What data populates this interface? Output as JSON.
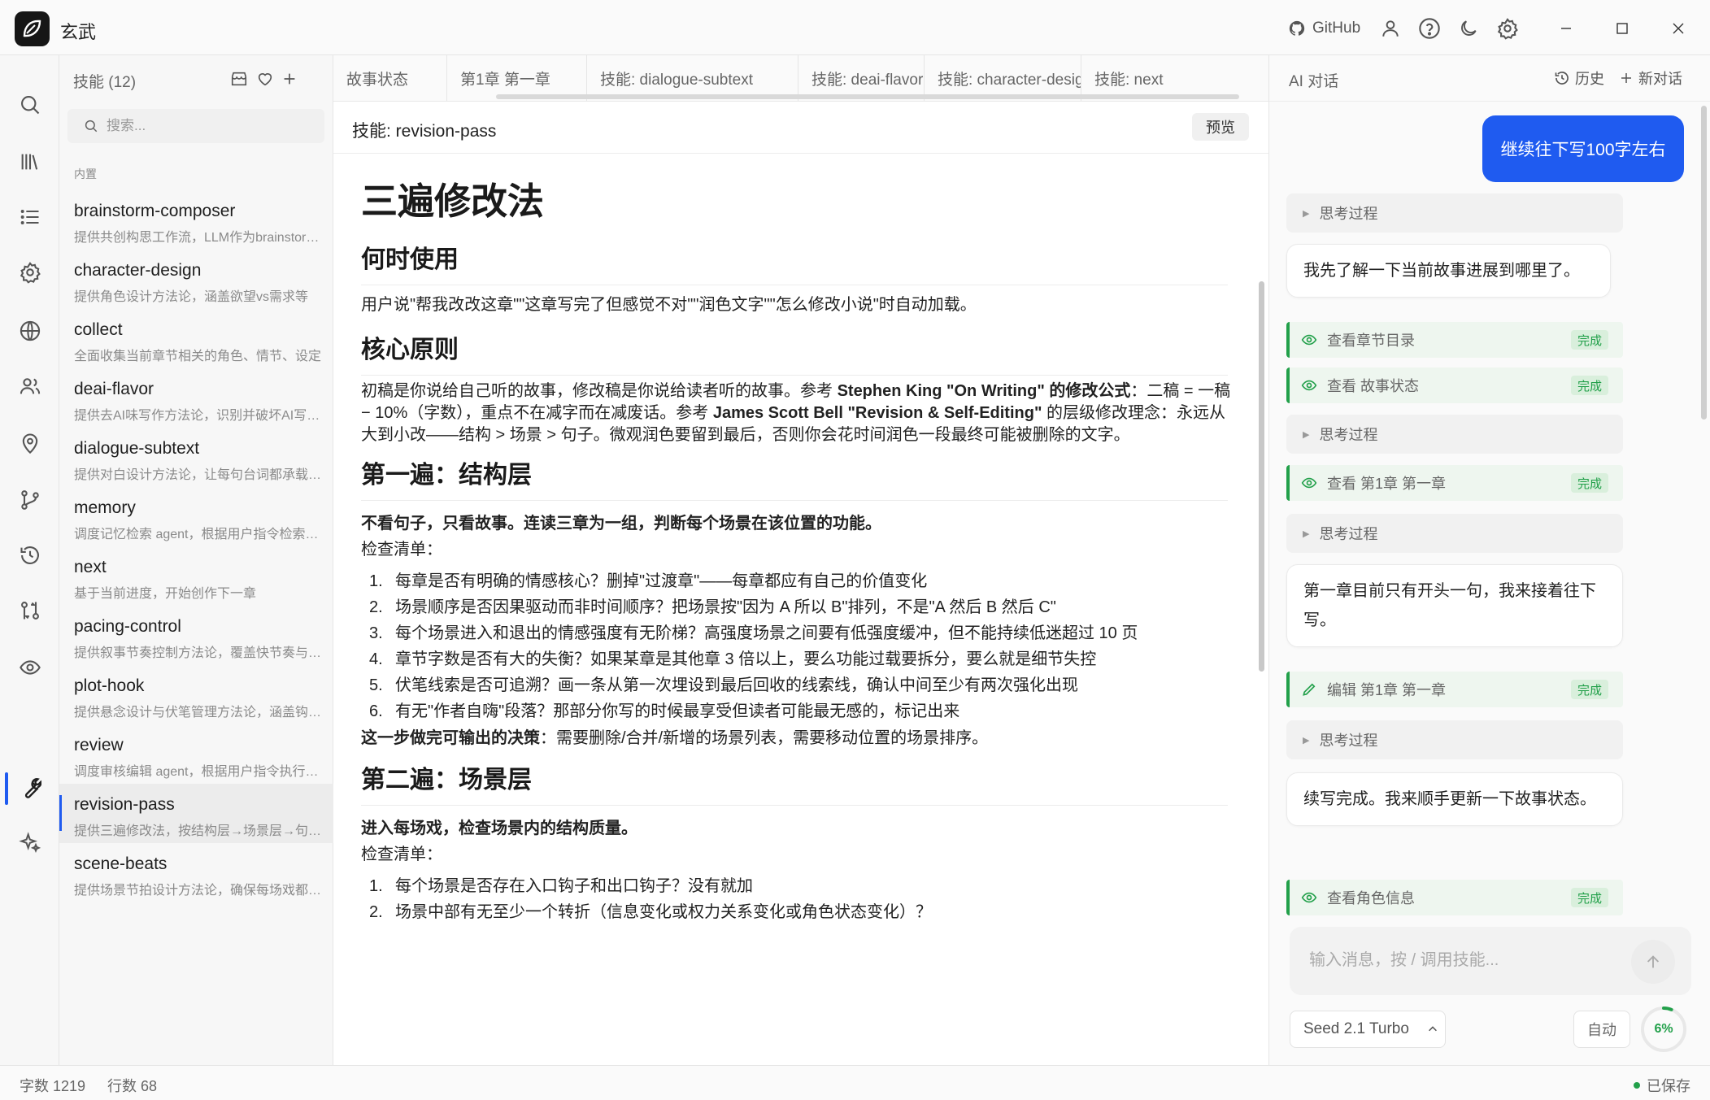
{
  "app": {
    "title": "玄武",
    "github_label": "GitHub"
  },
  "sidebar": {
    "header": "技能 (12)",
    "search_placeholder": "搜索...",
    "section_label": "内置",
    "items": [
      {
        "name": "brainstorm-composer",
        "desc": "提供共创构思工作流，LLM作为brainstorm伙伴"
      },
      {
        "name": "character-design",
        "desc": "提供角色设计方法论，涵盖欲望vs需求等"
      },
      {
        "name": "collect",
        "desc": "全面收集当前章节相关的角色、情节、设定"
      },
      {
        "name": "deai-flavor",
        "desc": "提供去AI味写作方法论，识别并破坏AI写作痕迹"
      },
      {
        "name": "dialogue-subtext",
        "desc": "提供对白设计方法论，让每句台词都承载潜台词"
      },
      {
        "name": "memory",
        "desc": "调度记忆检索 agent，根据用户指令检索记忆"
      },
      {
        "name": "next",
        "desc": "基于当前进度，开始创作下一章"
      },
      {
        "name": "pacing-control",
        "desc": "提供叙事节奏控制方法论，覆盖快节奏与慢节奏"
      },
      {
        "name": "plot-hook",
        "desc": "提供悬念设计与伏笔管理方法论，涵盖钩子类型"
      },
      {
        "name": "review",
        "desc": "调度审核编辑 agent，根据用户指令执行审核"
      },
      {
        "name": "revision-pass",
        "desc": "提供三遍修改法，按结构层→场景层→句子层"
      },
      {
        "name": "scene-beats",
        "desc": "提供场景节拍设计方法论，确保每场戏都有变化"
      }
    ],
    "active_index": 10
  },
  "editor": {
    "tabs": [
      "故事状态",
      "第1章 第一章",
      "技能: dialogue-subtext",
      "技能: deai-flavor",
      "技能: character-design",
      "技能: next"
    ],
    "doc_title": "技能: revision-pass",
    "preview_label": "预览",
    "content": {
      "h1": "三遍修改法",
      "s1_title": "何时使用",
      "s1_p": "用户说\"帮我改改这章\"\"这章写完了但感觉不对\"\"润色文字\"\"怎么修改小说\"时自动加载。",
      "s2_title": "核心原则",
      "s2_p_1": "初稿是你说给自己听的故事，修改稿是你说给读者听的故事。参考 ",
      "s2_p_2": "Stephen King \"On Writing\" 的修改公式",
      "s2_p_3": "：二稿 = 一稿 − 10%（字数），重点不在减字而在减废话。参考 ",
      "s2_p_4": "James Scott Bell \"Revision & Self-Editing\"",
      "s2_p_5": " 的层级修改理念：永远从大到小改——结构 > 场景 > 句子。微观润色要留到最后，否则你会花时间润色一段最终可能被删除的文字。",
      "s3_title": "第一遍：结构层",
      "s3_lead": "不看句子，只看故事。连读三章为一组，判断每个场景在该位置的功能。",
      "s3_checklist_label": "检查清单：",
      "s3_items": [
        "每章是否有明确的情感核心？删掉\"过渡章\"——每章都应有自己的价值变化",
        "场景顺序是否因果驱动而非时间顺序？把场景按\"因为 A 所以 B\"排列，不是\"A 然后 B 然后 C\"",
        "每个场景进入和退出的情感强度有无阶梯？高强度场景之间要有低强度缓冲，但不能持续低迷超过 10 页",
        "章节字数是否有大的失衡？如果某章是其他章 3 倍以上，要么功能过载要拆分，要么就是细节失控",
        "伏笔线索是否可追溯？画一条从第一次埋设到最后回收的线索线，确认中间至少有两次强化出现",
        "有无\"作者自嗨\"段落？那部分你写的时候最享受但读者可能最无感的，标记出来"
      ],
      "s3_output_bold": "这一步做完可输出的决策",
      "s3_output_rest": "：需要删除/合并/新增的场景列表，需要移动位置的场景排序。",
      "s4_title": "第二遍：场景层",
      "s4_lead": "进入每场戏，检查场景内的结构质量。",
      "s4_checklist_label": "检查清单：",
      "s4_items": [
        "每个场景是否存在入口钩子和出口钩子？没有就加",
        "场景中部有无至少一个转折（信息变化或权力关系变化或角色状态变化）？"
      ]
    }
  },
  "chat": {
    "title": "AI 对话",
    "history_label": "历史",
    "new_label": "新对话",
    "user_message": "继续往下写100字左右",
    "think_label": "思考过程",
    "done_label": "完成",
    "messages": {
      "ai_1": "我先了解一下当前故事进展到哪里了。",
      "tool_1": "查看章节目录",
      "tool_2": "查看 故事状态",
      "tool_3": "查看 第1章 第一章",
      "ai_2": "第一章目前只有开头一句，我来接着往下写。",
      "tool_4": "编辑 第1章 第一章",
      "ai_3": "续写完成。我来顺手更新一下故事状态。",
      "tool_5": "查看角色信息"
    },
    "input_placeholder": "输入消息，按 / 调用技能...",
    "model_label": "Seed 2.1 Turbo",
    "auto_label": "自动",
    "context_usage": "6%",
    "context_fraction": 0.06
  },
  "status": {
    "words": "字数 1219",
    "lines": "行数 68",
    "saved": "已保存"
  },
  "colors": {
    "accent": "#1f5bf0",
    "success": "#22a04a"
  }
}
